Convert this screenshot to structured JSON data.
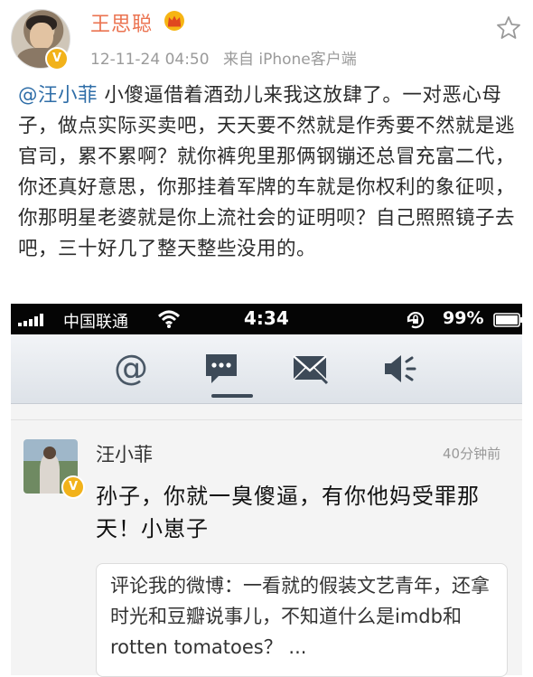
{
  "post": {
    "author": "王思聪",
    "timestamp": "12-11-24 04:50",
    "source": "来自 iPhone客户端",
    "mention": "@汪小菲",
    "body": " 小傻逼借着酒劲儿来我这放肆了。一对恶心母子，做点实际买卖吧，天天要不然就是作秀要不然就是逃官司，累不累啊？就你裤兜里那俩钢镚还总冒充富二代，你还真好意思，你那挂着军牌的车就是你权利的象征呗，你那明星老婆就是你上流社会的证明呗？自己照照镜子去吧，三十好几了整天整些没用的。",
    "verified_badge": "V",
    "icons": {
      "crown": "crown-icon",
      "star": "star-icon"
    }
  },
  "phone": {
    "status_bar": {
      "carrier": "中国联通",
      "time": "4:34",
      "battery": "99%"
    },
    "toolbar": {
      "tabs": [
        {
          "icon": "at-icon"
        },
        {
          "icon": "comment-icon",
          "active": true
        },
        {
          "icon": "mail-icon"
        },
        {
          "icon": "speaker-icon"
        }
      ]
    },
    "comment": {
      "author": "汪小菲",
      "time": "40分钟前",
      "verified_badge": "V",
      "text": "孙子，你就一臭傻逼，有你他妈受罪那天！小崽子",
      "quote": "评论我的微博：一看就的假装文艺青年，还拿时光和豆瓣说事儿，不知道什么是imdb和rotten tomatoes？ ..."
    }
  },
  "colors": {
    "author": "#eb7350",
    "mention": "#2f6ea8",
    "meta": "#9a9a9a",
    "badge": "#f2b21a",
    "statusbar_bg": "#050505"
  }
}
